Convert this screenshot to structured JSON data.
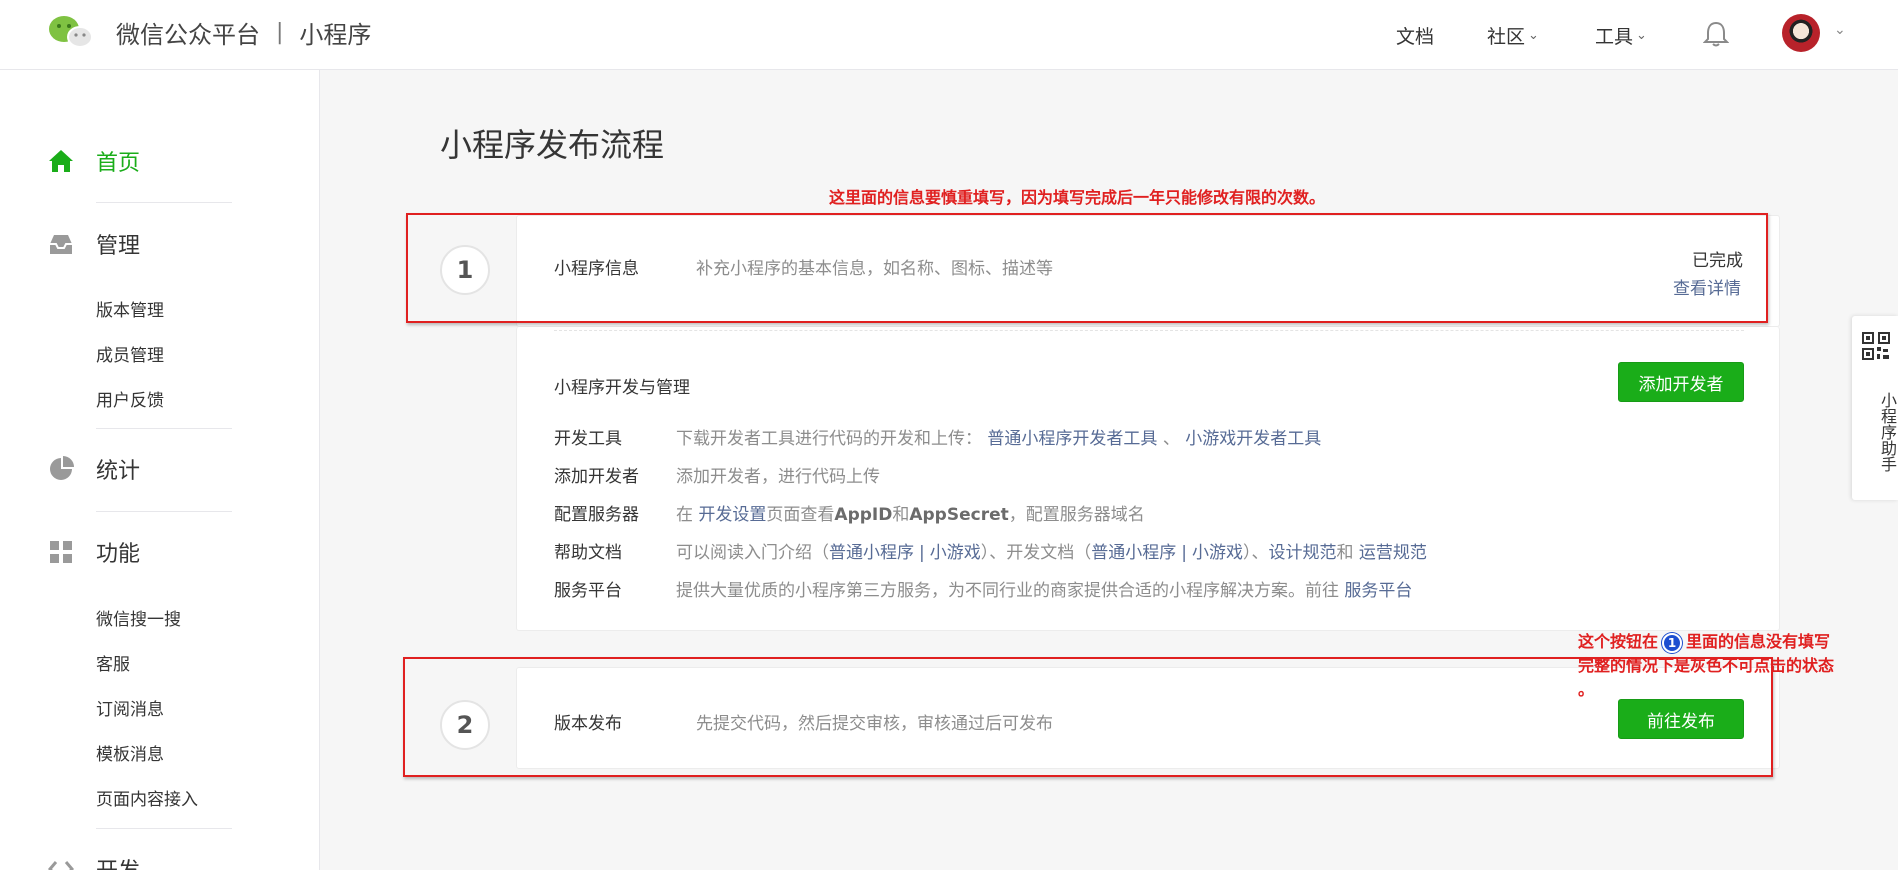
{
  "header": {
    "brand_main": "微信公众平台",
    "brand_sep": "|",
    "brand_sub": "小程序",
    "nav": {
      "docs": "文档",
      "community": "社区",
      "tools": "工具"
    },
    "chevron": "⌄"
  },
  "sidebar": {
    "home": "首页",
    "manage": "管理",
    "manage_items": [
      "版本管理",
      "成员管理",
      "用户反馈"
    ],
    "stats": "统计",
    "features": "功能",
    "feature_items": [
      "微信搜一搜",
      "客服",
      "订阅消息",
      "模板消息",
      "页面内容接入"
    ],
    "dev": "开发"
  },
  "main": {
    "title": "小程序发布流程",
    "note_top": "这里面的信息要慎重填写，因为填写完成后一年只能修改有限的次数。",
    "step1": {
      "num": "1",
      "title": "小程序信息",
      "desc": "补充小程序的基本信息，如名称、图标、描述等",
      "status": "已完成",
      "link": "查看详情"
    },
    "dev_section": {
      "title": "小程序开发与管理",
      "add_dev_button": "添加开发者",
      "rows": {
        "tools": {
          "label": "开发工具",
          "desc": "下载开发者工具进行代码的开发和上传：",
          "link1": "普通小程序开发者工具",
          "sep": "、",
          "link2": "小游戏开发者工具"
        },
        "add": {
          "label": "添加开发者",
          "desc": "添加开发者，进行代码上传"
        },
        "server": {
          "label": "配置服务器",
          "pre": "在 ",
          "link": "开发设置",
          "mid1": "页面查看",
          "appid": "AppID",
          "mid2": "和",
          "secret": "AppSecret",
          "post": "，配置服务器域名"
        },
        "help": {
          "label": "帮助文档",
          "pre": "可以阅读入门介绍（",
          "link1": "普通小程序",
          "bar": "|",
          "link2": "小游戏",
          "mid": "）、开发文档（",
          "link3": "普通小程序",
          "link4": "小游戏",
          "mid2": "）、",
          "link5": "设计规范",
          "and": "和",
          "link6": "运营规范"
        },
        "service": {
          "label": "服务平台",
          "desc": "提供大量优质的小程序第三方服务，为不同行业的商家提供合适的小程序解决方案。前往 ",
          "link": "服务平台"
        }
      }
    },
    "step2": {
      "num": "2",
      "title": "版本发布",
      "desc": "先提交代码，然后提交审核，审核通过后可发布",
      "button": "前往发布"
    },
    "note_bottom": {
      "pre": "这个按钮在",
      "circle": "1",
      "line1_post": "里面的信息没有填写",
      "line2": "完整的情况下是灰色不可点击的状态",
      "line3": "。"
    }
  },
  "helper": {
    "text": "小程序助手"
  },
  "colors": {
    "brand_green": "#1aad19",
    "link": "#576b95",
    "annotation_red": "#e02020"
  }
}
